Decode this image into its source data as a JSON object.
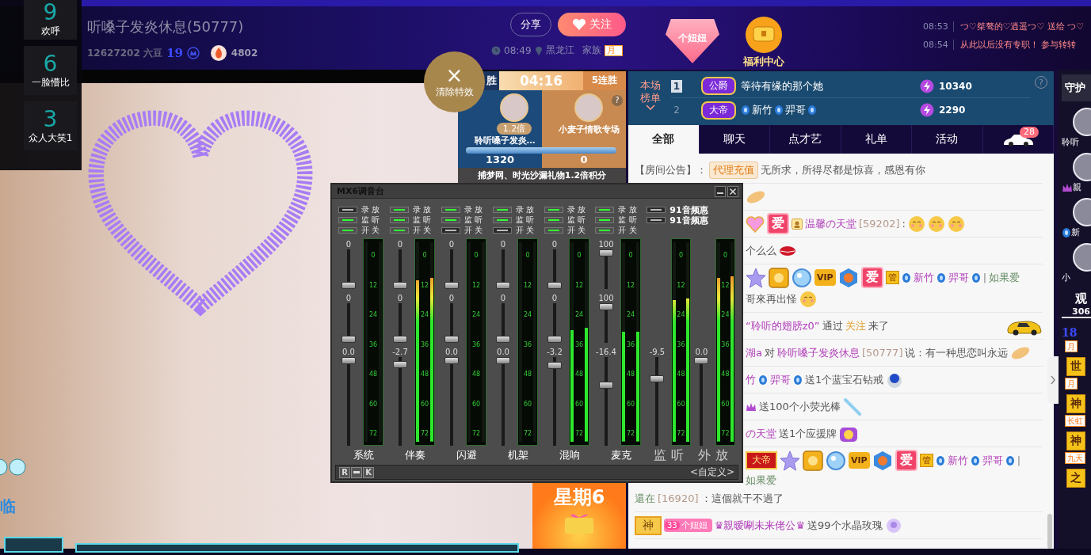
{
  "header": {
    "title": "听嗓子发炎休息(50777)",
    "beans": "12627202 六豆",
    "rank_number": "19",
    "fire_count": "4802",
    "share": "分享",
    "follow": "关注",
    "time": "08:49",
    "location": "黑龙江",
    "family_label": "家族",
    "family_tag": "月",
    "fan_badge": "个妞妞",
    "welfare": "福利中心",
    "ticker": [
      {
        "time": "08:53",
        "text": "つ♡桀骜的♡逍遥つ♡ 送给 つ♡"
      },
      {
        "time": "08:54",
        "text": "从此以后没有专职！ 参与转转"
      }
    ]
  },
  "effects_panel": [
    {
      "count": "9",
      "label": "欢呼"
    },
    {
      "count": "6",
      "label": "一脸懵比"
    },
    {
      "count": "3",
      "label": "众人大笑1"
    }
  ],
  "clear_effects": {
    "icon": "×",
    "label": "清除特效"
  },
  "pk": {
    "left_status": "胜",
    "timer": "04:16",
    "right_status": "5连胜",
    "left": {
      "multiplier": "1.2倍",
      "name": "聆听嗓子发炎…",
      "score": "1320"
    },
    "right": {
      "name": "小麦子情歌专场",
      "score": "0"
    },
    "help": "?",
    "progress": {
      "level": 1
    },
    "note": "捕梦网、时光沙漏礼物1.2倍积分"
  },
  "video": {
    "corner_text": "临",
    "banner": "星期6"
  },
  "rank": {
    "label": "本场榜单",
    "help": "?",
    "rows": [
      {
        "rank": "1",
        "highlighted": true,
        "badge": "公爵",
        "kind": "plain",
        "names": [
          "等待有缘的那个她"
        ],
        "score": "10340"
      },
      {
        "rank": "2",
        "highlighted": false,
        "badge": "大帝",
        "kind": "gem",
        "names": [
          "新竹",
          "羿哥"
        ],
        "score": "2290"
      }
    ]
  },
  "tabs": [
    {
      "kind": "text",
      "label": "全部",
      "selected": true
    },
    {
      "kind": "text",
      "label": "聊天",
      "selected": false
    },
    {
      "kind": "text",
      "label": "点才艺",
      "selected": false
    },
    {
      "kind": "text",
      "label": "礼单",
      "selected": false
    },
    {
      "kind": "text",
      "label": "活动",
      "selected": false
    },
    {
      "kind": "car",
      "badge": "28",
      "selected": false
    }
  ],
  "chat": [
    {
      "lines": [
        [
          {
            "kind": "label",
            "text": "【房间公告】："
          },
          {
            "kind": "tag",
            "text": "代理充值"
          },
          {
            "kind": "text",
            "text": "无所求，所得尽都是惊喜，感恩有你"
          }
        ]
      ]
    },
    {
      "lines": [
        [
          {
            "kind": "hand"
          }
        ]
      ]
    },
    {
      "lines": [
        [
          {
            "kind": "heart"
          },
          {
            "kind": "love",
            "text": "爱"
          },
          {
            "kind": "user"
          },
          {
            "kind": "name",
            "text": "温馨の天堂"
          },
          {
            "kind": "id",
            "text": "[59202]"
          },
          {
            "kind": "text",
            "text": ":"
          },
          {
            "kind": "emoji"
          },
          {
            "kind": "emoji"
          },
          {
            "kind": "emoji"
          }
        ]
      ]
    },
    {
      "lines": [
        [
          {
            "kind": "text",
            "text": "个么么"
          },
          {
            "kind": "lips"
          }
        ]
      ]
    },
    {
      "lines": [
        [
          {
            "kind": "star"
          },
          {
            "kind": "medal"
          },
          {
            "kind": "orb"
          },
          {
            "kind": "vip",
            "text": "VIP"
          },
          {
            "kind": "cube"
          },
          {
            "kind": "love",
            "text": "爱"
          },
          {
            "kind": "admin",
            "text": "管"
          },
          {
            "kind": "gem"
          },
          {
            "kind": "name",
            "text": "新竹"
          },
          {
            "kind": "gem"
          },
          {
            "kind": "name",
            "text": "羿哥"
          },
          {
            "kind": "gem"
          },
          {
            "kind": "sep",
            "text": "|"
          },
          {
            "kind": "alt",
            "text": "如果爱"
          }
        ],
        [
          {
            "kind": "text",
            "text": "哥來再出怪"
          },
          {
            "kind": "emoji"
          }
        ]
      ]
    },
    {
      "lines": [
        [
          {
            "kind": "name",
            "text": "“聆听的翅膀z0”"
          },
          {
            "kind": "text",
            "text": "通过"
          },
          {
            "kind": "link",
            "text": "关注"
          },
          {
            "kind": "text",
            "text": "来了"
          },
          {
            "kind": "car"
          }
        ]
      ]
    },
    {
      "lines": [
        [
          {
            "kind": "name",
            "text": "湖a"
          },
          {
            "kind": "text",
            "text": "对"
          },
          {
            "kind": "name",
            "text": "聆听嗓子发炎休息"
          },
          {
            "kind": "id",
            "text": "[50777]"
          },
          {
            "kind": "text",
            "text": "说：有一种思恋叫永远"
          },
          {
            "kind": "hand"
          }
        ]
      ]
    },
    {
      "lines": [
        [
          {
            "kind": "name",
            "text": "竹"
          },
          {
            "kind": "gem"
          },
          {
            "kind": "name",
            "text": "羿哥"
          },
          {
            "kind": "gem"
          },
          {
            "kind": "text",
            "text": "送1个蓝宝石钻戒"
          },
          {
            "kind": "ring"
          }
        ]
      ]
    },
    {
      "lines": [
        [
          {
            "kind": "crown"
          },
          {
            "kind": "text",
            "text": "送100个小荧光棒"
          },
          {
            "kind": "wand"
          }
        ]
      ]
    },
    {
      "lines": [
        [
          {
            "kind": "name",
            "text": "の天堂"
          },
          {
            "kind": "text",
            "text": "送1个应援牌"
          },
          {
            "kind": "cheer"
          }
        ]
      ]
    },
    {
      "lines": [
        [
          {
            "kind": "emperor",
            "text": "大帝"
          },
          {
            "kind": "star"
          },
          {
            "kind": "medal"
          },
          {
            "kind": "orb"
          },
          {
            "kind": "vip",
            "text": "VIP"
          },
          {
            "kind": "cube"
          },
          {
            "kind": "love",
            "text": "爱"
          },
          {
            "kind": "admin",
            "text": "管"
          },
          {
            "kind": "gem"
          },
          {
            "kind": "name",
            "text": "新竹"
          },
          {
            "kind": "gem"
          },
          {
            "kind": "name",
            "text": "羿哥"
          },
          {
            "kind": "gem"
          },
          {
            "kind": "sep",
            "text": "|"
          },
          {
            "kind": "alt",
            "text": "如果爱"
          }
        ],
        [
          {
            "kind": "alt",
            "text": "還在"
          },
          {
            "kind": "id",
            "text": "[16920]"
          },
          {
            "kind": "text",
            "text": "：這個就干不過了"
          }
        ]
      ]
    },
    {
      "lines": [
        [
          {
            "kind": "god",
            "text": "神"
          },
          {
            "kind": "fan",
            "number": "33",
            "text": "个妞妞"
          },
          {
            "kind": "name",
            "text": "♛親暧唰未来佬公♛"
          },
          {
            "kind": "text",
            "text": "送99个水晶玫瑰"
          },
          {
            "kind": "rose"
          }
        ]
      ]
    }
  ],
  "guard": {
    "title": "守护",
    "members": [
      {
        "kind": "plain",
        "name": "聆听"
      },
      {
        "kind": "crown",
        "name": "親"
      },
      {
        "kind": "gem",
        "name": "新"
      },
      {
        "kind": "plain",
        "name": "小"
      }
    ]
  },
  "viewers": {
    "title": "观",
    "count": "306",
    "items": [
      {
        "kind": "level",
        "text": "18"
      },
      {
        "kind": "tag",
        "text": "月"
      },
      {
        "kind": "badge",
        "text": "世"
      },
      {
        "kind": "tag",
        "text": "月"
      },
      {
        "kind": "badge",
        "text": "神"
      },
      {
        "kind": "tag",
        "text": "长虹"
      },
      {
        "kind": "badge",
        "text": "神"
      },
      {
        "kind": "tag",
        "text": "九天"
      },
      {
        "kind": "badge",
        "text": "之"
      }
    ]
  },
  "mixer": {
    "title": "MX6调音台",
    "channels": [
      {
        "label": "系统",
        "toggles": [
          {
            "label": "录 放",
            "on": false
          },
          {
            "label": "监 听",
            "on": true
          },
          {
            "label": "开 关",
            "on": true
          }
        ],
        "sliders": [
          {
            "reading": "0",
            "level": 0
          },
          {
            "reading": "0",
            "level": 0
          },
          {
            "reading": "0.0",
            "level": 1
          }
        ],
        "meter": {
          "ticks": [
            "0",
            "12",
            "24",
            "36",
            "48",
            "60",
            "72"
          ],
          "bars": [
            {
              "level": 0
            },
            {
              "level": 0
            }
          ]
        }
      },
      {
        "label": "伴奏",
        "toggles": [
          {
            "label": "录 放",
            "on": true
          },
          {
            "label": "监 听",
            "on": true
          },
          {
            "label": "开 关",
            "on": true
          }
        ],
        "sliders": [
          {
            "reading": "0",
            "level": 0
          },
          {
            "reading": "0",
            "level": 0
          },
          {
            "reading": "-2.7",
            "level": 0.95
          }
        ],
        "meter": {
          "ticks": [
            "0",
            "12",
            "24",
            "36",
            "48",
            "60",
            "72"
          ],
          "bars": [
            {
              "level": 0.81
            },
            {
              "level": 0.82
            }
          ]
        }
      },
      {
        "label": "闪避",
        "toggles": [
          {
            "label": "录 放",
            "on": true
          },
          {
            "label": "监 听",
            "on": true
          },
          {
            "label": "开 关",
            "on": false
          }
        ],
        "sliders": [
          {
            "reading": "0",
            "level": 0
          },
          {
            "reading": "0",
            "level": 0
          },
          {
            "reading": "0.0",
            "level": 1
          }
        ],
        "meter": {
          "ticks": [
            "0",
            "12",
            "24",
            "36",
            "48",
            "60",
            "72"
          ],
          "bars": [
            {
              "level": 0
            },
            {
              "level": 0
            }
          ]
        }
      },
      {
        "label": "机架",
        "toggles": [
          {
            "label": "录 放",
            "on": true
          },
          {
            "label": "监 听",
            "on": true
          },
          {
            "label": "开 关",
            "on": false
          }
        ],
        "sliders": [
          {
            "reading": "0",
            "level": 0
          },
          {
            "reading": "0",
            "level": 0
          },
          {
            "reading": "0.0",
            "level": 1
          }
        ],
        "meter": {
          "ticks": [
            "0",
            "12",
            "24",
            "36",
            "48",
            "60",
            "72"
          ],
          "bars": [
            {
              "level": 0
            },
            {
              "level": 0
            }
          ]
        }
      },
      {
        "label": "混响",
        "toggles": [
          {
            "label": "录 放",
            "on": true
          },
          {
            "label": "监 听",
            "on": true
          },
          {
            "label": "开 关",
            "on": true
          }
        ],
        "sliders": [
          {
            "reading": "0",
            "level": 0
          },
          {
            "reading": "0",
            "level": 0
          },
          {
            "reading": "-3.2",
            "level": 0.94
          }
        ],
        "meter": {
          "ticks": [
            "0",
            "12",
            "24",
            "36",
            "48",
            "60",
            "72"
          ],
          "bars": [
            {
              "level": 0.56
            },
            {
              "level": 0.57
            }
          ]
        }
      },
      {
        "label": "麦克",
        "toggles": [
          {
            "label": "录 放",
            "on": true
          },
          {
            "label": "监 听",
            "on": true
          },
          {
            "label": "开 关",
            "on": true
          }
        ],
        "sliders": [
          {
            "reading": "100",
            "level": 1
          },
          {
            "reading": "100",
            "level": 1
          },
          {
            "reading": "-16.4",
            "level": 0.7
          }
        ],
        "meter": {
          "ticks": [
            "0",
            "12",
            "24",
            "36",
            "48",
            "60",
            "72"
          ],
          "bars": [
            {
              "level": 0.55
            },
            {
              "level": 0.55
            }
          ]
        }
      }
    ],
    "extra_toggles": [
      {
        "label": "91音频惠",
        "on": false
      },
      {
        "label": "91音频惠",
        "on": false
      }
    ],
    "outputs": [
      {
        "label": "监 听",
        "slider": {
          "reading": "-9.5",
          "level": 0.78
        },
        "meter": {
          "ticks": [
            "0",
            "12",
            "24",
            "36",
            "48",
            "60",
            "72"
          ],
          "bars": [
            {
              "level": 0.71
            },
            {
              "level": 0.72
            }
          ]
        }
      },
      {
        "label": "外 放",
        "slider": {
          "reading": "0.0",
          "level": 1
        },
        "meter": {
          "ticks": [
            "0",
            "12",
            "24",
            "36",
            "48",
            "60",
            "72"
          ],
          "bars": [
            {
              "level": 0.82
            },
            {
              "level": 0.83
            }
          ]
        }
      }
    ],
    "footer_buttons": [
      "R",
      "K"
    ],
    "preset": "<自定义>"
  }
}
